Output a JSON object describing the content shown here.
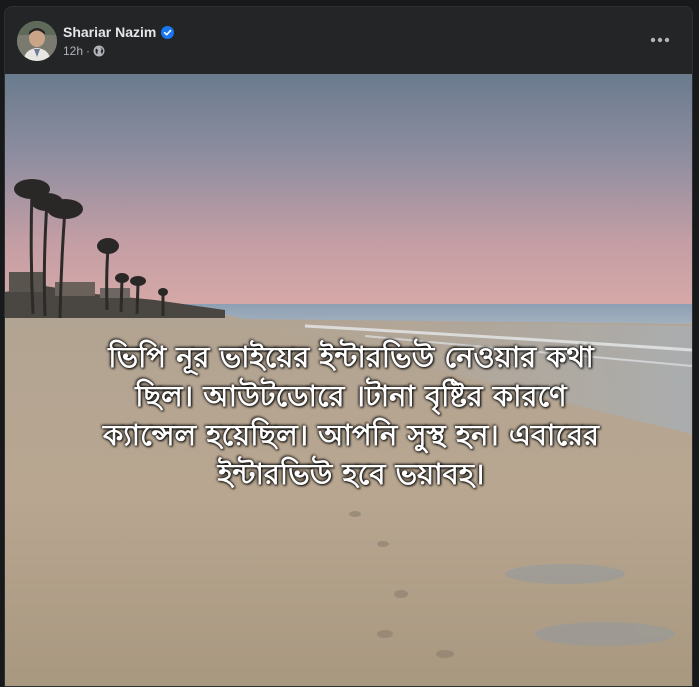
{
  "post": {
    "author": {
      "name": "Shariar Nazim",
      "verified": true,
      "avatar_icon": "profile-photo"
    },
    "timestamp": "12h",
    "audience_icon": "globe-icon",
    "more_icon": "more-horizontal-icon",
    "image": {
      "scene": "beach-sunset-with-palm-trees",
      "overlay_text_lines": [
        "ভিপি নূর ভাইয়ের ইন্টারভিউ নেওয়ার কথা",
        "ছিল। আউটডোরে ।টানা বৃষ্টির কারণে",
        "ক্যান্সেল হয়েছিল। আপনি সুস্থ হন। এবারের",
        "ইন্টারভিউ হবে ভয়াবহ।"
      ]
    }
  },
  "colors": {
    "page_background": "#18191a",
    "card_background": "#242526",
    "name_text": "#e4e6eb",
    "meta_text": "#b0b3b8",
    "verified_badge": "#1877f2"
  }
}
